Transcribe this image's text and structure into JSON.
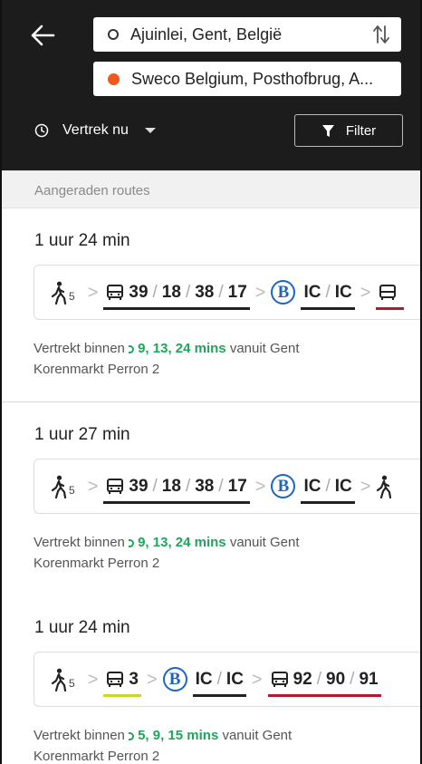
{
  "header": {
    "from": "Ajuinlei, Gent, België",
    "to": "Sweco Belgium, Posthofbrug, A...",
    "depart_label": "Vertrek nu",
    "filter_label": "Filter"
  },
  "section_title": "Aangeraden routes",
  "colors": {
    "header_bg": "#1c1c1c",
    "destination_dot": "#ef5a1c",
    "realtime_green": "#1fa65a",
    "train_blue": "#1d65c1",
    "line_dark": "#222222",
    "line_red": "#b01a2c",
    "line_yellow": "#c6d92a"
  },
  "routes": [
    {
      "duration": "1 uur 24 min",
      "walk_minutes": "5",
      "bus1": {
        "lines": [
          "39",
          "18",
          "38",
          "17"
        ]
      },
      "train": {
        "lines": [
          "IC",
          "IC"
        ]
      },
      "info_prefix": "Vertrekt binnen",
      "realtime": "9, 13, 24 mins",
      "info_suffix": "vanuit Gent",
      "stop": "Korenmarkt Perron 2"
    },
    {
      "duration": "1 uur 27 min",
      "walk_minutes": "5",
      "bus1": {
        "lines": [
          "39",
          "18",
          "38",
          "17"
        ]
      },
      "train": {
        "lines": [
          "IC",
          "IC"
        ]
      },
      "info_prefix": "Vertrekt binnen",
      "realtime": "9, 13, 24 mins",
      "info_suffix": "vanuit Gent",
      "stop": "Korenmarkt Perron 2"
    },
    {
      "duration": "1 uur 24 min",
      "walk_minutes": "5",
      "bus1": {
        "lines": [
          "3"
        ]
      },
      "train": {
        "lines": [
          "IC",
          "IC"
        ]
      },
      "bus2": {
        "lines": [
          "92",
          "90",
          "91"
        ]
      },
      "info_prefix": "Vertrekt binnen",
      "realtime": "5, 9, 15 mins",
      "info_suffix": "vanuit Gent",
      "stop": "Korenmarkt Perron 2"
    }
  ]
}
